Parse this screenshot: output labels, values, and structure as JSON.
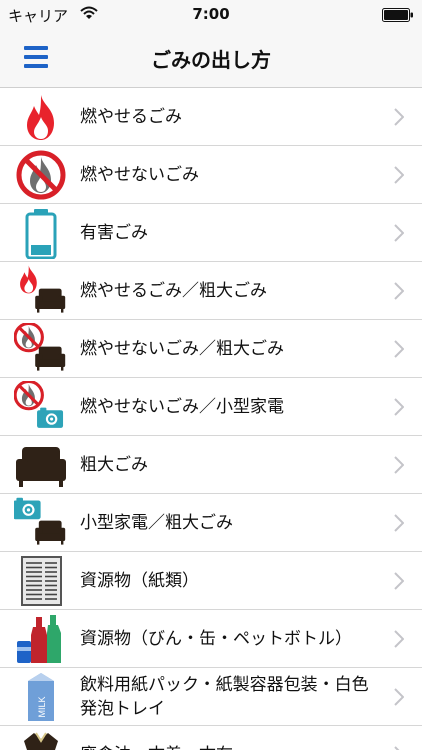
{
  "status_bar": {
    "carrier": "キャリア",
    "time": "7:00"
  },
  "nav": {
    "title": "ごみの出し方",
    "menu_icon": "hamburger-menu-icon"
  },
  "colors": {
    "accent": "#1e63c7",
    "fire_red": "#e8232c",
    "prohibit_red": "#d82028",
    "gray": "#6f6f6f",
    "sofa_dark": "#2f2217",
    "camera_teal": "#2da3b8",
    "battery_teal": "#2aa2b8"
  },
  "items": [
    {
      "label": "燃やせるごみ",
      "icon": "burnable-fire-icon"
    },
    {
      "label": "燃やせないごみ",
      "icon": "non-burnable-prohibited-icon"
    },
    {
      "label": "有害ごみ",
      "icon": "battery-icon"
    },
    {
      "label": "燃やせるごみ／粗大ごみ",
      "icon": "fire-and-sofa-icon"
    },
    {
      "label": "燃やせないごみ／粗大ごみ",
      "icon": "prohibited-and-sofa-icon"
    },
    {
      "label": "燃やせないごみ／小型家電",
      "icon": "prohibited-and-camera-icon"
    },
    {
      "label": "粗大ごみ",
      "icon": "sofa-icon"
    },
    {
      "label": "小型家電／粗大ごみ",
      "icon": "camera-and-sofa-icon"
    },
    {
      "label": "資源物（紙類）",
      "icon": "newspaper-icon"
    },
    {
      "label": "資源物（びん・缶・ペットボトル）",
      "icon": "bottles-and-can-icon"
    },
    {
      "label": "飲料用紙パック・紙製容器包装・白色発泡トレイ",
      "icon": "milk-carton-icon"
    },
    {
      "label": "廃食油・古着・古布",
      "icon": "clothing-icon"
    }
  ]
}
